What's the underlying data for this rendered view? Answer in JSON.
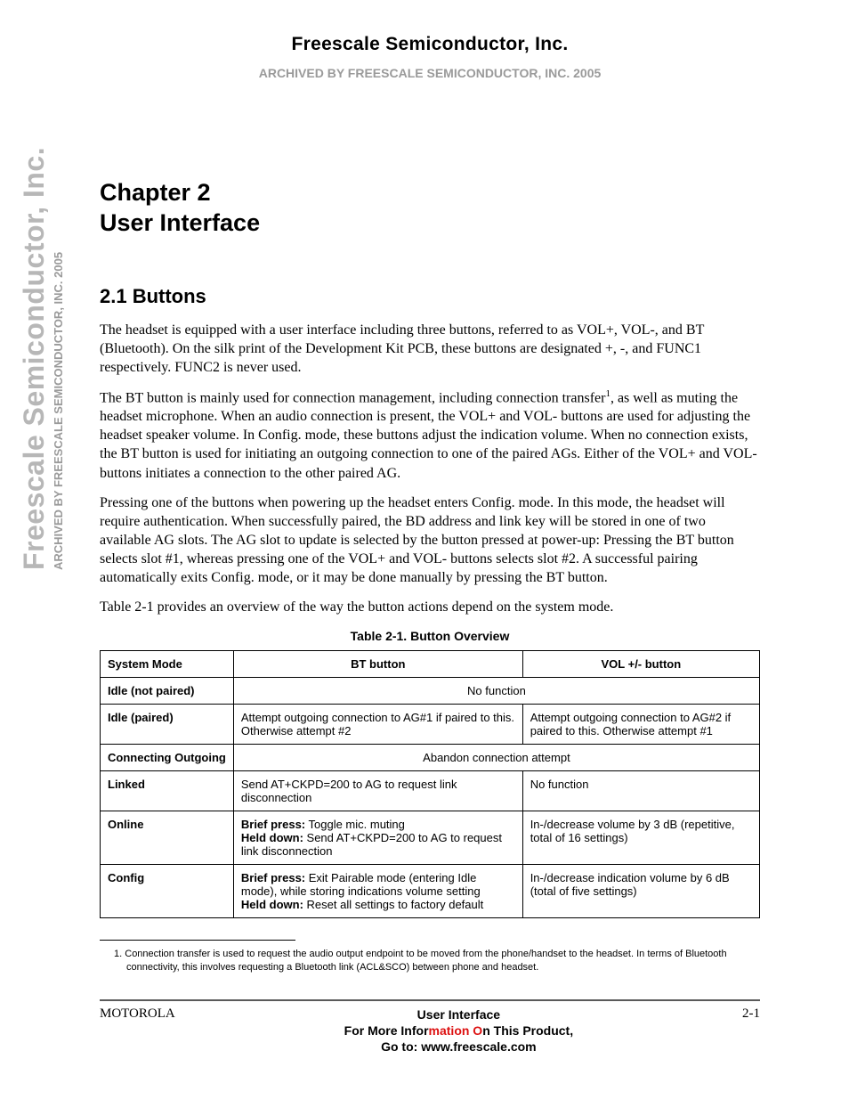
{
  "header": {
    "company": "Freescale Semiconductor, Inc.",
    "archived": "ARCHIVED BY FREESCALE SEMICONDUCTOR, INC. 2005"
  },
  "chapter": {
    "line1": "Chapter 2",
    "line2": "User Interface"
  },
  "section": {
    "number": "2.1",
    "title": "Buttons",
    "heading": "2.1   Buttons"
  },
  "paragraphs": {
    "p1": "The headset is equipped with a user interface including three buttons, referred to as VOL+, VOL-, and BT (Bluetooth). On the silk print of the Development Kit PCB, these buttons are designated +, -, and FUNC1 respectively. FUNC2 is never used.",
    "p2_pre": "The BT button is mainly used for connection management, including connection transfer",
    "p2_sup": "1",
    "p2_post": ", as well as muting the headset microphone. When an audio connection is present, the VOL+ and VOL- buttons are used for adjusting the headset speaker volume. In Config. mode, these buttons adjust the indication volume. When no connection exists, the BT button is used for initiating an outgoing connection to one of the paired AGs. Either of the VOL+ and VOL- buttons initiates a connection to the other paired AG.",
    "p3": "Pressing one of the buttons when powering up the headset enters Config. mode. In this mode, the headset will require authentication. When successfully paired, the BD address and link key will be stored in one of two available AG slots. The AG slot to update is selected by the button pressed at power-up: Pressing the BT button selects slot #1, whereas pressing one of the VOL+ and VOL- buttons selects slot #2. A successful pairing automatically exits Config. mode, or it may be done manually by pressing the BT button.",
    "p4": "Table 2-1 provides an overview of the way the button actions depend on the system mode."
  },
  "table": {
    "caption": "Table 2-1.   Button Overview",
    "headers": {
      "col1": "System Mode",
      "col2": "BT button",
      "col3": "VOL +/- button"
    },
    "rows": {
      "r1": {
        "mode": "Idle (not paired)",
        "span": "No function"
      },
      "r2": {
        "mode": "Idle (paired)",
        "bt": "Attempt outgoing connection to AG#1 if paired to this. Otherwise attempt #2",
        "vol": "Attempt outgoing connection to AG#2 if paired to this. Otherwise attempt #1"
      },
      "r3": {
        "mode": "Connecting Outgoing",
        "span": "Abandon connection attempt"
      },
      "r4": {
        "mode": "Linked",
        "bt": "Send AT+CKPD=200 to AG to request link disconnection",
        "vol": "No function"
      },
      "r5": {
        "mode": "Online",
        "bt_brief_label": "Brief press:",
        "bt_brief": " Toggle mic. muting",
        "bt_held_label": "Held down:",
        "bt_held": " Send AT+CKPD=200 to AG to request link disconnection",
        "vol": "In-/decrease volume by 3 dB (repetitive, total of 16 settings)"
      },
      "r6": {
        "mode": "Config",
        "bt_brief_label": "Brief press:",
        "bt_brief": " Exit Pairable mode (entering Idle mode), while storing indications volume setting",
        "bt_held_label": "Held down:",
        "bt_held": " Reset all settings to factory default",
        "vol": "In-/decrease indication volume by 6 dB (total of five settings)"
      }
    }
  },
  "footnote": {
    "num": "1.",
    "text": "Connection transfer is used to request the audio output endpoint to be moved from the phone/handset to the headset. In terms of Bluetooth connectivity, this involves requesting a Bluetooth link (ACL&SCO) between phone and headset."
  },
  "footer": {
    "left": "MOTOROLA",
    "center_title": "User Interface",
    "tagline1_a": "For More Infor",
    "tagline1_prelim": "mation O",
    "tagline1_b": "n This Product,",
    "tagline2": "Go to: www.freescale.com",
    "right": "2-1"
  },
  "side": {
    "big": "Freescale Semiconductor, Inc.",
    "small": "ARCHIVED BY FREESCALE SEMICONDUCTOR, INC. 2005"
  }
}
